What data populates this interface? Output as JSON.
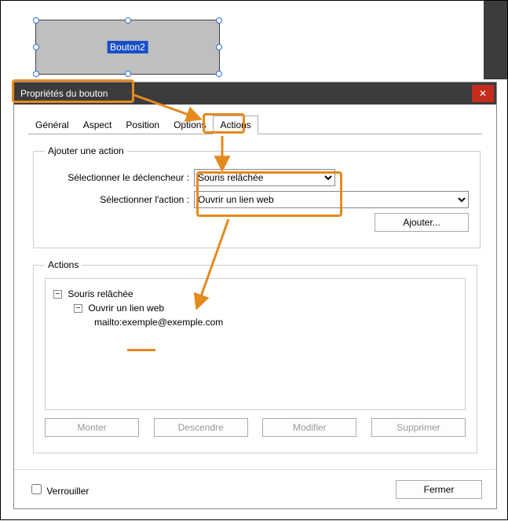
{
  "canvas": {
    "button_label": "Bouton2"
  },
  "dialog": {
    "title": "Propriétés du bouton",
    "tabs": [
      "Général",
      "Aspect",
      "Position",
      "Options",
      "Actions"
    ],
    "active_tab": 4,
    "add_action": {
      "legend": "Ajouter une action",
      "trigger_label": "Sélectionner le déclencheur :",
      "trigger_value": "Souris relâchée",
      "action_label": "Sélectionner l'action :",
      "action_value": "Ouvrir un lien web",
      "add_btn": "Ajouter..."
    },
    "actions_list": {
      "legend": "Actions",
      "root": "Souris relâchée",
      "child": "Ouvrir un lien web",
      "leaf": "mailto:exemple@exemple.com",
      "buttons": [
        "Monter",
        "Descendre",
        "Modifier",
        "Supprimer"
      ]
    },
    "footer": {
      "lock_label": "Verrouiller",
      "close_btn": "Fermer"
    }
  }
}
